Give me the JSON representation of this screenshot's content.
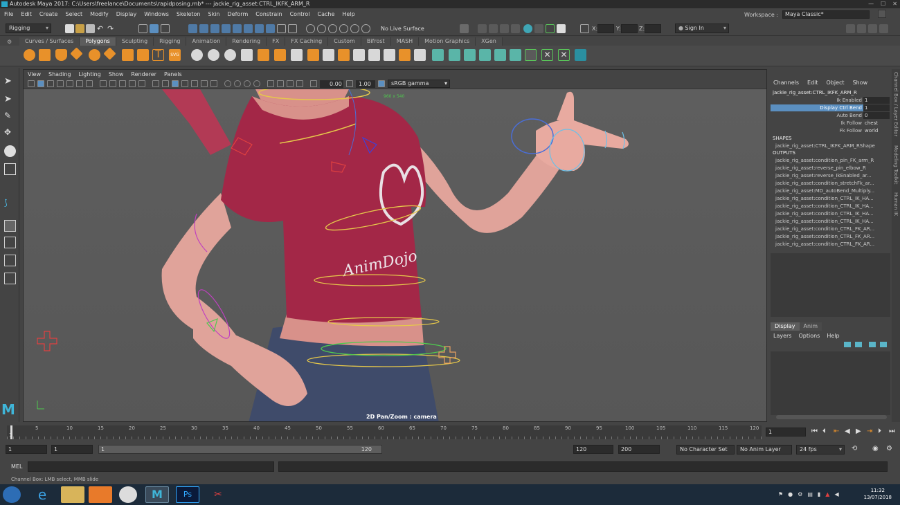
{
  "window": {
    "title": "Autodesk Maya 2017: C:\\Users\\freelance\\Documents\\rapidposing.mb*  ---  jackie_rig_asset:CTRL_IKFK_ARM_R"
  },
  "menubar": {
    "items": [
      "File",
      "Edit",
      "Create",
      "Select",
      "Modify",
      "Display",
      "Windows",
      "Skeleton",
      "Skin",
      "Deform",
      "Constrain",
      "Control",
      "Cache",
      "Help"
    ]
  },
  "workspace": {
    "label": "Workspace :",
    "value": "Maya Classic*"
  },
  "statusline": {
    "menuset": "Rigging",
    "live_surface": "No Live Surface",
    "coords": {
      "x_label": "X:",
      "y_label": "Y:",
      "z_label": "Z:"
    },
    "sign_in": "Sign In"
  },
  "shelf": {
    "tabs": [
      "Curves / Surfaces",
      "Polygons",
      "Sculpting",
      "Rigging",
      "Animation",
      "Rendering",
      "FX",
      "FX Caching",
      "Custom",
      "Bifrost",
      "MASH",
      "Motion Graphics",
      "XGen"
    ],
    "active_tab": "Polygons"
  },
  "viewport": {
    "menu": [
      "View",
      "Shading",
      "Lighting",
      "Show",
      "Renderer",
      "Panels"
    ],
    "exposure": "0.00",
    "gamma": "1.00",
    "colorspace": "sRGB gamma",
    "resolution": "960 x 540",
    "hud_label": "2D Pan/Zoom : camera",
    "shirt_logo": "AnimDojo"
  },
  "channelbox": {
    "menu": [
      "Channels",
      "Edit",
      "Object",
      "Show"
    ],
    "node": "jackie_rig_asset:CTRL_IKFK_ARM_R",
    "attributes": [
      {
        "name": "Ik Enabled",
        "value": "1"
      },
      {
        "name": "Display Ctrl Bend",
        "value": "1"
      },
      {
        "name": "Auto Bend",
        "value": "0"
      },
      {
        "name": "Ik Follow",
        "value": "chest"
      },
      {
        "name": "Fk Follow",
        "value": "world"
      }
    ],
    "selected_attribute": "Display Ctrl Bend",
    "shapes_header": "SHAPES",
    "shape": "jackie_rig_asset:CTRL_IKFK_ARM_RShape",
    "outputs_header": "OUTPUTS",
    "outputs": [
      "jackie_rig_asset:condition_pin_FK_arm_R",
      "jackie_rig_asset:reverse_pin_elbow_R",
      "jackie_rig_asset:reverse_IkEnabled_ar...",
      "jackie_rig_asset:condition_stretchFk_ar...",
      "jackie_rig_asset:MD_autoBend_Multiply...",
      "jackie_rig_asset:condition_CTRL_IK_HA...",
      "jackie_rig_asset:condition_CTRL_IK_HA...",
      "jackie_rig_asset:condition_CTRL_IK_HA...",
      "jackie_rig_asset:condition_CTRL_IK_HA...",
      "jackie_rig_asset:condition_CTRL_FK_AR...",
      "jackie_rig_asset:condition_CTRL_FK_AR...",
      "jackie_rig_asset:condition_CTRL_FK_AR..."
    ],
    "layer_tabs": [
      "Display",
      "Anim"
    ],
    "layer_menu": [
      "Layers",
      "Options",
      "Help"
    ],
    "side_tabs": [
      "Channel Box / Layer Editor",
      "Modeling Toolkit",
      "Human IK"
    ]
  },
  "timeline": {
    "ticks": [
      "5",
      "10",
      "15",
      "20",
      "25",
      "30",
      "35",
      "40",
      "45",
      "50",
      "55",
      "60",
      "65",
      "70",
      "75",
      "80",
      "85",
      "90",
      "95",
      "100",
      "105",
      "110",
      "115",
      "120"
    ],
    "current_frame_marker": "1",
    "current_frame_field": "1"
  },
  "range": {
    "start_field": "1",
    "start_inner": "1",
    "slider_start": "1",
    "slider_end": "120",
    "end_inner": "120",
    "end_field": "200",
    "character_set": "No Character Set",
    "anim_layer": "No Anim Layer",
    "fps": "24 fps"
  },
  "command": {
    "lang": "MEL"
  },
  "help_line": "Channel Box: LMB select, MMB slide",
  "taskbar": {
    "time": "11:32",
    "date": "13/07/2018"
  }
}
